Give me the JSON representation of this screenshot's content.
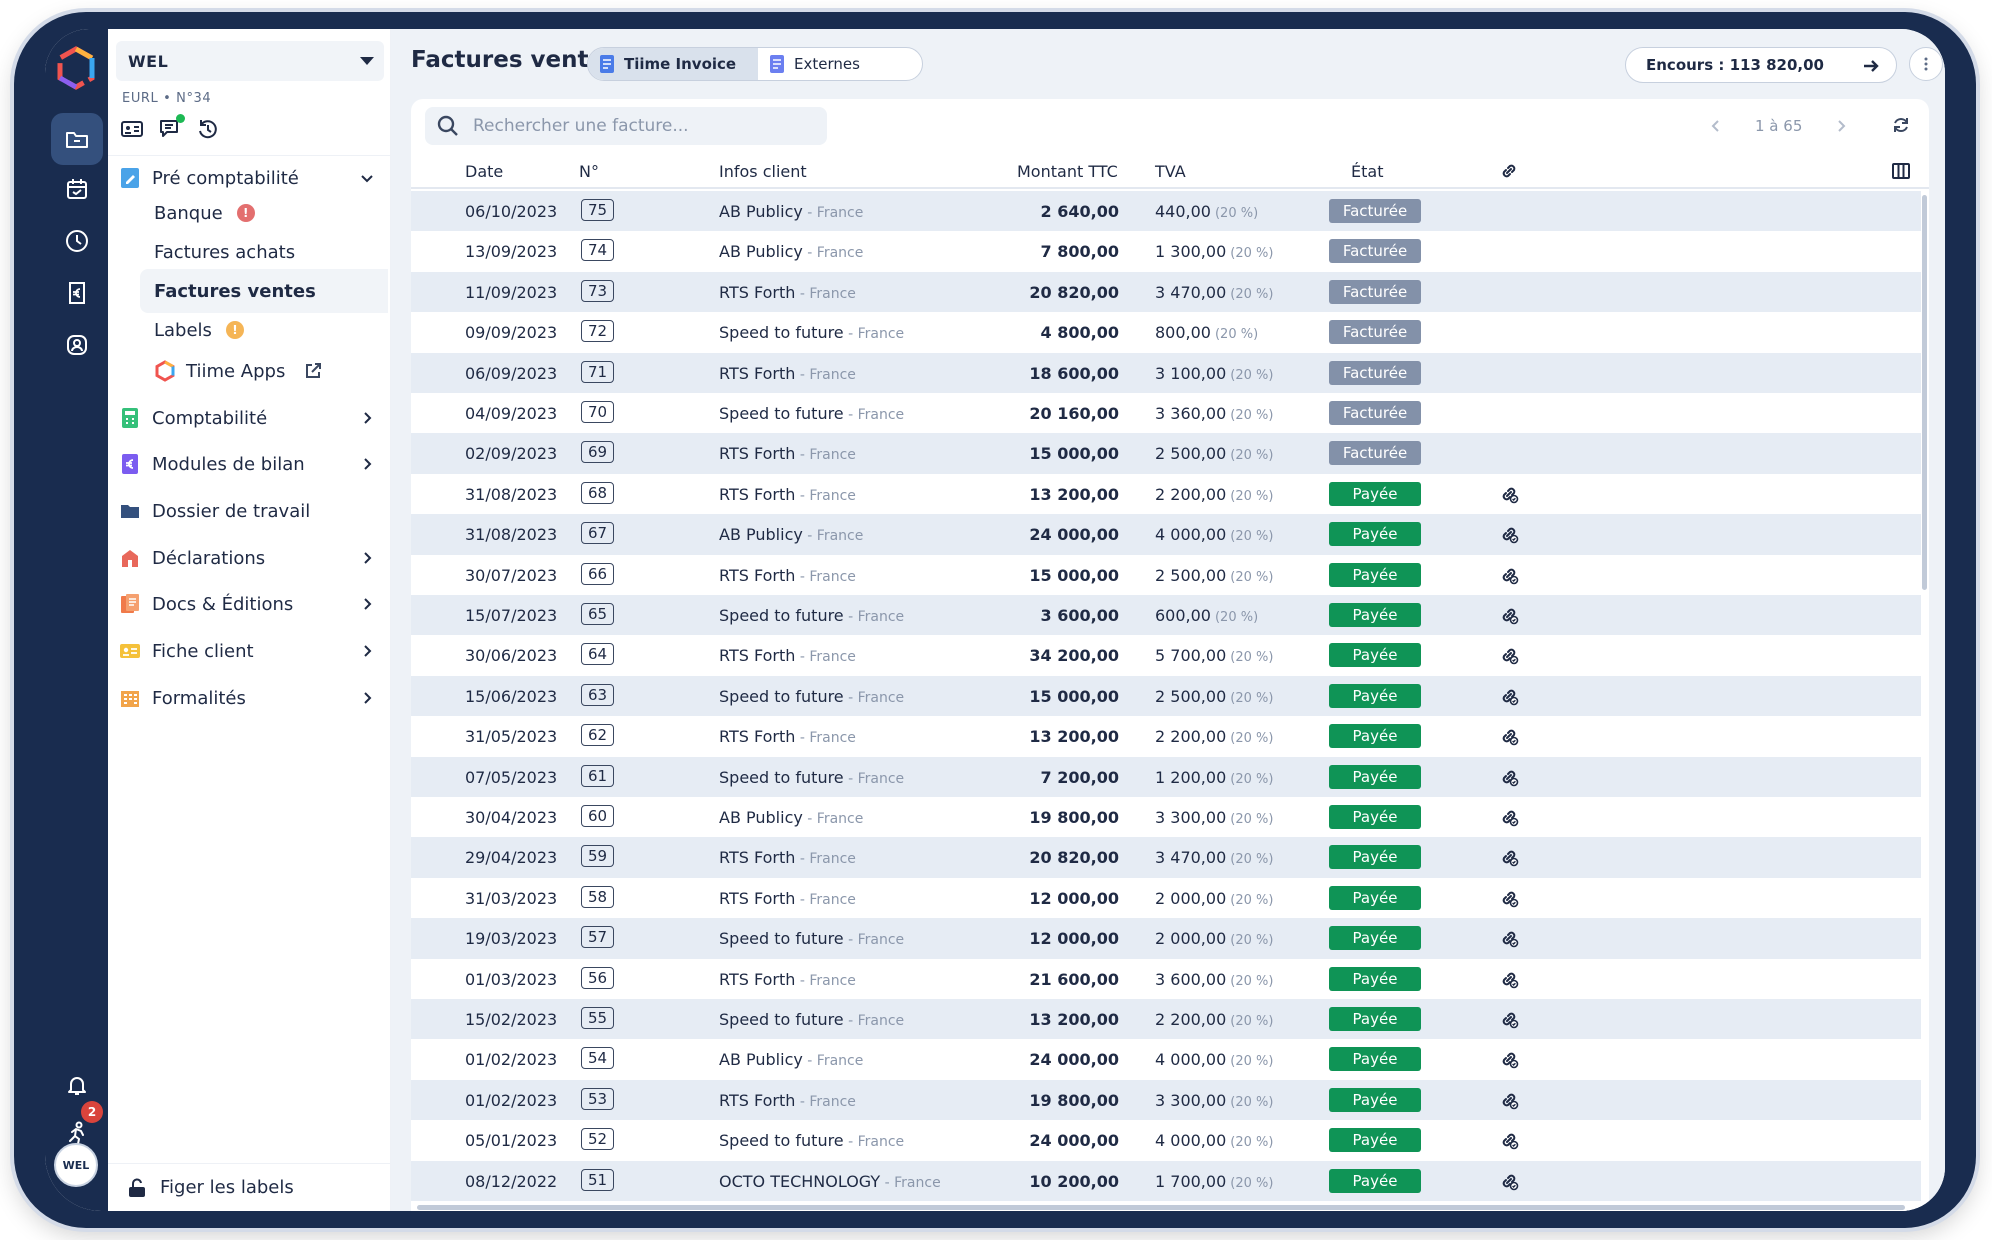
{
  "sidebar": {
    "company": "WEL",
    "company_sub": "EURL • N°34",
    "pre_compta": "Pré comptabilité",
    "banque": "Banque",
    "banque_badge": "!",
    "factures_achats": "Factures achats",
    "factures_ventes": "Factures ventes",
    "labels": "Labels",
    "labels_badge": "!",
    "tiime_apps": "Tiime Apps",
    "comptabilite": "Comptabilité",
    "modules_bilan": "Modules de bilan",
    "dossier_travail": "Dossier de travail",
    "declarations": "Déclarations",
    "docs_editions": "Docs & Éditions",
    "fiche_client": "Fiche client",
    "formalites": "Formalités",
    "figer_labels": "Figer les labels"
  },
  "rail": {
    "notif_count": "2",
    "avatar": "WEL"
  },
  "header": {
    "title": "Factures ventes",
    "tab_tiime": "Tiime Invoice",
    "tab_externes": "Externes",
    "encours": "Encours : 113 820,00"
  },
  "toolbar": {
    "search_placeholder": "Rechercher une facture...",
    "pager": "1 à 65"
  },
  "table": {
    "headers": {
      "date": "Date",
      "no": "N°",
      "client": "Infos client",
      "amount": "Montant TTC",
      "tva": "TVA",
      "state": "État"
    },
    "rows": [
      {
        "date": "06/10/2023",
        "no": "75",
        "client": "AB Publicy",
        "country": "France",
        "amount": "2 640,00",
        "tva": "440,00",
        "pct": "(20 %)",
        "state": "Facturée",
        "linked": false
      },
      {
        "date": "13/09/2023",
        "no": "74",
        "client": "AB Publicy",
        "country": "France",
        "amount": "7 800,00",
        "tva": "1 300,00",
        "pct": "(20 %)",
        "state": "Facturée",
        "linked": false
      },
      {
        "date": "11/09/2023",
        "no": "73",
        "client": "RTS Forth",
        "country": "France",
        "amount": "20 820,00",
        "tva": "3 470,00",
        "pct": "(20 %)",
        "state": "Facturée",
        "linked": false
      },
      {
        "date": "09/09/2023",
        "no": "72",
        "client": "Speed to future",
        "country": "France",
        "amount": "4 800,00",
        "tva": "800,00",
        "pct": "(20 %)",
        "state": "Facturée",
        "linked": false
      },
      {
        "date": "06/09/2023",
        "no": "71",
        "client": "RTS Forth",
        "country": "France",
        "amount": "18 600,00",
        "tva": "3 100,00",
        "pct": "(20 %)",
        "state": "Facturée",
        "linked": false
      },
      {
        "date": "04/09/2023",
        "no": "70",
        "client": "Speed to future",
        "country": "France",
        "amount": "20 160,00",
        "tva": "3 360,00",
        "pct": "(20 %)",
        "state": "Facturée",
        "linked": false
      },
      {
        "date": "02/09/2023",
        "no": "69",
        "client": "RTS Forth",
        "country": "France",
        "amount": "15 000,00",
        "tva": "2 500,00",
        "pct": "(20 %)",
        "state": "Facturée",
        "linked": false
      },
      {
        "date": "31/08/2023",
        "no": "68",
        "client": "RTS Forth",
        "country": "France",
        "amount": "13 200,00",
        "tva": "2 200,00",
        "pct": "(20 %)",
        "state": "Payée",
        "linked": true
      },
      {
        "date": "31/08/2023",
        "no": "67",
        "client": "AB Publicy",
        "country": "France",
        "amount": "24 000,00",
        "tva": "4 000,00",
        "pct": "(20 %)",
        "state": "Payée",
        "linked": true
      },
      {
        "date": "30/07/2023",
        "no": "66",
        "client": "RTS Forth",
        "country": "France",
        "amount": "15 000,00",
        "tva": "2 500,00",
        "pct": "(20 %)",
        "state": "Payée",
        "linked": true
      },
      {
        "date": "15/07/2023",
        "no": "65",
        "client": "Speed to future",
        "country": "France",
        "amount": "3 600,00",
        "tva": "600,00",
        "pct": "(20 %)",
        "state": "Payée",
        "linked": true
      },
      {
        "date": "30/06/2023",
        "no": "64",
        "client": "RTS Forth",
        "country": "France",
        "amount": "34 200,00",
        "tva": "5 700,00",
        "pct": "(20 %)",
        "state": "Payée",
        "linked": true
      },
      {
        "date": "15/06/2023",
        "no": "63",
        "client": "Speed to future",
        "country": "France",
        "amount": "15 000,00",
        "tva": "2 500,00",
        "pct": "(20 %)",
        "state": "Payée",
        "linked": true
      },
      {
        "date": "31/05/2023",
        "no": "62",
        "client": "RTS Forth",
        "country": "France",
        "amount": "13 200,00",
        "tva": "2 200,00",
        "pct": "(20 %)",
        "state": "Payée",
        "linked": true
      },
      {
        "date": "07/05/2023",
        "no": "61",
        "client": "Speed to future",
        "country": "France",
        "amount": "7 200,00",
        "tva": "1 200,00",
        "pct": "(20 %)",
        "state": "Payée",
        "linked": true
      },
      {
        "date": "30/04/2023",
        "no": "60",
        "client": "AB Publicy",
        "country": "France",
        "amount": "19 800,00",
        "tva": "3 300,00",
        "pct": "(20 %)",
        "state": "Payée",
        "linked": true
      },
      {
        "date": "29/04/2023",
        "no": "59",
        "client": "RTS Forth",
        "country": "France",
        "amount": "20 820,00",
        "tva": "3 470,00",
        "pct": "(20 %)",
        "state": "Payée",
        "linked": true
      },
      {
        "date": "31/03/2023",
        "no": "58",
        "client": "RTS Forth",
        "country": "France",
        "amount": "12 000,00",
        "tva": "2 000,00",
        "pct": "(20 %)",
        "state": "Payée",
        "linked": true
      },
      {
        "date": "19/03/2023",
        "no": "57",
        "client": "Speed to future",
        "country": "France",
        "amount": "12 000,00",
        "tva": "2 000,00",
        "pct": "(20 %)",
        "state": "Payée",
        "linked": true
      },
      {
        "date": "01/03/2023",
        "no": "56",
        "client": "RTS Forth",
        "country": "France",
        "amount": "21 600,00",
        "tva": "3 600,00",
        "pct": "(20 %)",
        "state": "Payée",
        "linked": true
      },
      {
        "date": "15/02/2023",
        "no": "55",
        "client": "Speed to future",
        "country": "France",
        "amount": "13 200,00",
        "tva": "2 200,00",
        "pct": "(20 %)",
        "state": "Payée",
        "linked": true
      },
      {
        "date": "01/02/2023",
        "no": "54",
        "client": "AB Publicy",
        "country": "France",
        "amount": "24 000,00",
        "tva": "4 000,00",
        "pct": "(20 %)",
        "state": "Payée",
        "linked": true
      },
      {
        "date": "01/02/2023",
        "no": "53",
        "client": "RTS Forth",
        "country": "France",
        "amount": "19 800,00",
        "tva": "3 300,00",
        "pct": "(20 %)",
        "state": "Payée",
        "linked": true
      },
      {
        "date": "05/01/2023",
        "no": "52",
        "client": "Speed to future",
        "country": "France",
        "amount": "24 000,00",
        "tva": "4 000,00",
        "pct": "(20 %)",
        "state": "Payée",
        "linked": true
      },
      {
        "date": "08/12/2022",
        "no": "51",
        "client": "OCTO TECHNOLOGY",
        "country": "France",
        "amount": "10 200,00",
        "tva": "1 700,00",
        "pct": "(20 %)",
        "state": "Payée",
        "linked": true
      }
    ]
  },
  "colors": {
    "rail": "#192c4f",
    "status_invoiced": "#8391a9",
    "status_paid": "#0f9456",
    "row_alt": "#e6ecf4"
  }
}
